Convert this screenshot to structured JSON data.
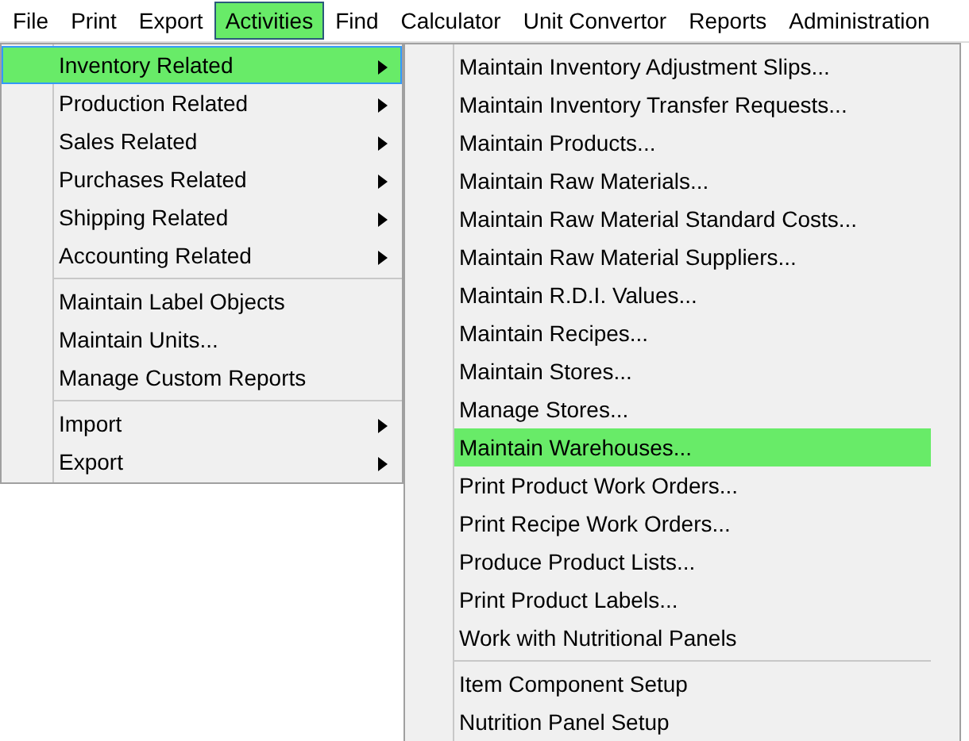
{
  "menubar": [
    {
      "label": "File",
      "selected": false
    },
    {
      "label": "Print",
      "selected": false
    },
    {
      "label": "Export",
      "selected": false
    },
    {
      "label": "Activities",
      "selected": true
    },
    {
      "label": "Find",
      "selected": false
    },
    {
      "label": "Calculator",
      "selected": false
    },
    {
      "label": "Unit Convertor",
      "selected": false
    },
    {
      "label": "Reports",
      "selected": false
    },
    {
      "label": "Administration",
      "selected": false
    }
  ],
  "menu": {
    "groups": [
      [
        {
          "label": "Inventory Related",
          "has_submenu": true,
          "selected": true
        },
        {
          "label": "Production Related",
          "has_submenu": true,
          "selected": false
        },
        {
          "label": "Sales Related",
          "has_submenu": true,
          "selected": false
        },
        {
          "label": "Purchases Related",
          "has_submenu": true,
          "selected": false
        },
        {
          "label": "Shipping Related",
          "has_submenu": true,
          "selected": false
        },
        {
          "label": "Accounting Related",
          "has_submenu": true,
          "selected": false
        }
      ],
      [
        {
          "label": "Maintain Label Objects",
          "has_submenu": false,
          "selected": false
        },
        {
          "label": "Maintain Units...",
          "has_submenu": false,
          "selected": false
        },
        {
          "label": "Manage Custom Reports",
          "has_submenu": false,
          "selected": false
        }
      ],
      [
        {
          "label": "Import",
          "has_submenu": true,
          "selected": false
        },
        {
          "label": "Export",
          "has_submenu": true,
          "selected": false
        }
      ]
    ]
  },
  "submenu": {
    "groups": [
      [
        {
          "label": "Maintain Inventory Adjustment Slips...",
          "selected": false
        },
        {
          "label": "Maintain Inventory Transfer Requests...",
          "selected": false
        },
        {
          "label": "Maintain Products...",
          "selected": false
        },
        {
          "label": "Maintain Raw Materials...",
          "selected": false
        },
        {
          "label": "Maintain Raw Material Standard Costs...",
          "selected": false
        },
        {
          "label": "Maintain Raw Material Suppliers...",
          "selected": false
        },
        {
          "label": "Maintain R.D.I. Values...",
          "selected": false
        },
        {
          "label": "Maintain Recipes...",
          "selected": false
        },
        {
          "label": "Maintain Stores...",
          "selected": false
        },
        {
          "label": "Manage Stores...",
          "selected": false
        },
        {
          "label": "Maintain Warehouses...",
          "selected": true
        },
        {
          "label": "Print Product Work Orders...",
          "selected": false
        },
        {
          "label": "Print Recipe Work Orders...",
          "selected": false
        },
        {
          "label": "Produce Product Lists...",
          "selected": false
        },
        {
          "label": "Print Product Labels...",
          "selected": false
        },
        {
          "label": "Work with Nutritional Panels",
          "selected": false
        }
      ],
      [
        {
          "label": "Item Component Setup",
          "selected": false
        },
        {
          "label": "Nutrition Panel Setup",
          "selected": false
        }
      ]
    ]
  }
}
